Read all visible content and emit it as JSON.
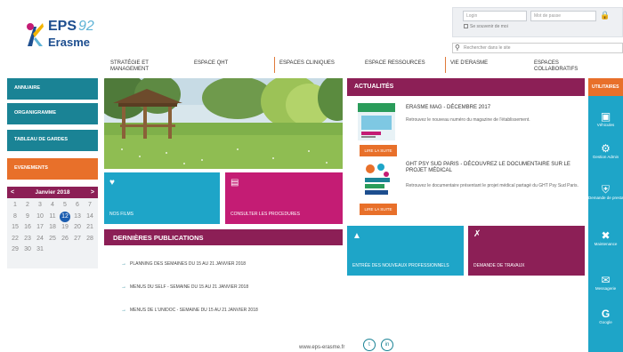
{
  "header": {
    "logo_title": "EPS",
    "logo_num": "92",
    "logo_sub": "Erasme",
    "login_placeholder": "Login",
    "password_placeholder": "Mot de passe",
    "remember_label": "Se souvenir de moi",
    "search_placeholder": "Rechercher dans le site"
  },
  "nav": [
    "STRATÉGIE ET MANAGEMENT",
    "ESPACE QHT",
    "ESPACES CLINIQUES",
    "ESPACE RESSOURCES",
    "VIE D'ERASME",
    "ESPACES COLLABORATIFS"
  ],
  "sidebar": [
    "ANNUAIRE",
    "ORGANIGRAMME",
    "TABLEAU DE GARDES",
    "EVENEMENTS"
  ],
  "calendar": {
    "title": "Janvier 2018",
    "prev": "<",
    "next": ">",
    "days": [
      "1",
      "2",
      "3",
      "4",
      "5",
      "6",
      "7",
      "8",
      "9",
      "10",
      "11",
      "12",
      "13",
      "14",
      "15",
      "16",
      "17",
      "18",
      "19",
      "20",
      "21",
      "22",
      "23",
      "24",
      "25",
      "26",
      "27",
      "28",
      "29",
      "30",
      "31"
    ],
    "active_day": "12"
  },
  "tiles": {
    "tile1": {
      "label": "NOS FILMS"
    },
    "tile2": {
      "label": "CONSULTER LES PROCEDURES"
    },
    "tile3": {
      "label": "ENTRÉE DES NOUVEAUX PROFESSIONNELS"
    },
    "tile4": {
      "label": "DEMANDE DE TRAVAUX"
    }
  },
  "publications": {
    "title": "DERNIÈRES PUBLICATIONS",
    "items": [
      "PLANNING DES SEMAINES DU 15 AU 21 JANVIER 2018",
      "MENUS DU SELF - SEMAINE DU 15 AU 21 JANVIER 2018",
      "MENUS DE L'UNIDOC - SEMAINE DU 15 AU 21 JANVIER 2018"
    ]
  },
  "news": {
    "title": "ACTUALITÉS",
    "items": [
      {
        "title": "ERASME MAG - DÉCEMBRE 2017",
        "text": "Retrouvez le nouveau numéro du magazine de l'établissement.",
        "button": "LIRE LA SUITE"
      },
      {
        "title": "GHT PSY SUD PARIS - DÉCOUVREZ LE DOCUMENTAIRE SUR LE PROJET MÉDICAL",
        "text": "Retrouvez le documentaire présentant le projet médical partagé du GHT Psy Sud Paris.",
        "button": "LIRE LA SUITE"
      }
    ]
  },
  "rail": {
    "title": "UTILITAIRES",
    "items": [
      {
        "icon": "car-icon",
        "label": "Véhicules"
      },
      {
        "icon": "gear-icon",
        "label": "Gestion Admin"
      },
      {
        "icon": "cart-icon",
        "label": "Demande de prestations"
      },
      {
        "icon": "tools-icon",
        "label": "Maintenance"
      },
      {
        "icon": "mail-icon",
        "label": "Messagerie"
      },
      {
        "icon": "google-icon",
        "label": "Google"
      }
    ]
  },
  "footer": {
    "url": "www.eps-erasme.fr",
    "twitter": "t",
    "linkedin": "in"
  },
  "colors": {
    "teal": "#1a8395",
    "orange": "#e8702a",
    "plum": "#8c1f56",
    "cyan": "#1ea5c8",
    "pink": "#c41c74",
    "blue": "#1b5db0"
  }
}
